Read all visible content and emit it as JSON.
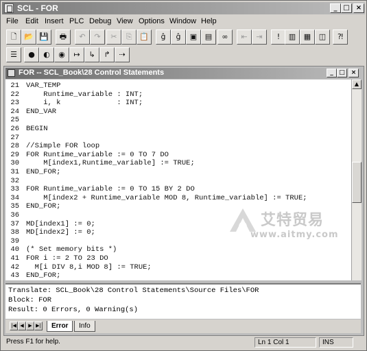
{
  "window": {
    "title": "SCL - FOR",
    "min": "_",
    "max": "□",
    "close": "×"
  },
  "menu": [
    {
      "label": "File"
    },
    {
      "label": "Edit"
    },
    {
      "label": "Insert"
    },
    {
      "label": "PLC"
    },
    {
      "label": "Debug"
    },
    {
      "label": "View"
    },
    {
      "label": "Options"
    },
    {
      "label": "Window"
    },
    {
      "label": "Help"
    }
  ],
  "toolbar1": [
    {
      "icon": "new-file-icon",
      "glyph": "🗋",
      "enabled": true
    },
    {
      "icon": "open-folder-icon",
      "glyph": "📂",
      "enabled": true
    },
    {
      "icon": "save-icon",
      "glyph": "💾",
      "enabled": true
    },
    {
      "icon": "print-icon",
      "glyph": "🖶",
      "enabled": true
    },
    {
      "icon": "undo-icon",
      "glyph": "↶",
      "enabled": false
    },
    {
      "icon": "redo-icon",
      "glyph": "↷",
      "enabled": false
    },
    {
      "icon": "cut-icon",
      "glyph": "✂",
      "enabled": false
    },
    {
      "icon": "copy-icon",
      "glyph": "⎘",
      "enabled": false
    },
    {
      "icon": "paste-icon",
      "glyph": "📋",
      "enabled": false
    },
    {
      "icon": "find-icon",
      "glyph": "ĝ",
      "enabled": true
    },
    {
      "icon": "replace-icon",
      "glyph": "ĝ",
      "enabled": true
    },
    {
      "icon": "compile-icon",
      "glyph": "▣",
      "enabled": true
    },
    {
      "icon": "download-icon",
      "glyph": "▤",
      "enabled": true
    },
    {
      "icon": "monitor-glasses-icon",
      "glyph": "∞",
      "enabled": true
    },
    {
      "icon": "go-to-start-icon",
      "glyph": "⇤",
      "enabled": false
    },
    {
      "icon": "go-to-end-icon",
      "glyph": "⇥",
      "enabled": false
    },
    {
      "icon": "important-icon",
      "glyph": "!",
      "enabled": true
    },
    {
      "icon": "window-cascade-icon",
      "glyph": "▥",
      "enabled": true
    },
    {
      "icon": "window-tile-icon",
      "glyph": "▦",
      "enabled": true
    },
    {
      "icon": "window-split-icon",
      "glyph": "◫",
      "enabled": true
    },
    {
      "icon": "help-what-is-icon",
      "glyph": "⁈",
      "enabled": true
    }
  ],
  "toolbar2": [
    {
      "icon": "list-icon",
      "glyph": "☰",
      "enabled": true
    },
    {
      "icon": "breakpoint-icon",
      "glyph": "●",
      "enabled": true
    },
    {
      "icon": "breakpoint-toggle-icon",
      "glyph": "◐",
      "enabled": true
    },
    {
      "icon": "watch-icon",
      "glyph": "◉",
      "enabled": true
    },
    {
      "icon": "step-icon",
      "glyph": "↦",
      "enabled": true
    },
    {
      "icon": "step-into-icon",
      "glyph": "↳",
      "enabled": true
    },
    {
      "icon": "step-out-icon",
      "glyph": "↱",
      "enabled": true
    },
    {
      "icon": "run-to-cursor-icon",
      "glyph": "⇢",
      "enabled": true
    }
  ],
  "child": {
    "title": "FOR -- SCL_Book\\28 Control Statements",
    "min": "_",
    "max": "□",
    "close": "×"
  },
  "code": [
    {
      "n": "21",
      "t": "VAR_TEMP"
    },
    {
      "n": "22",
      "t": "    Runtime_variable : INT;"
    },
    {
      "n": "23",
      "t": "    i, k             : INT;"
    },
    {
      "n": "24",
      "t": "END_VAR"
    },
    {
      "n": "25",
      "t": ""
    },
    {
      "n": "26",
      "t": "BEGIN"
    },
    {
      "n": "27",
      "t": ""
    },
    {
      "n": "28",
      "t": "//Simple FOR loop"
    },
    {
      "n": "29",
      "t": "FOR Runtime_variable := 0 TO 7 DO"
    },
    {
      "n": "30",
      "t": "    M[index1,Runtime_variable] := TRUE;"
    },
    {
      "n": "31",
      "t": "END_FOR;"
    },
    {
      "n": "32",
      "t": ""
    },
    {
      "n": "33",
      "t": "FOR Runtime_variable := 0 TO 15 BY 2 DO"
    },
    {
      "n": "34",
      "t": "    M[index2 + Runtime_variable MOD 8, Runtime_variable] := TRUE;"
    },
    {
      "n": "35",
      "t": "END_FOR;"
    },
    {
      "n": "36",
      "t": ""
    },
    {
      "n": "37",
      "t": "MD[index1] := 0;"
    },
    {
      "n": "38",
      "t": "MD[index2] := 0;"
    },
    {
      "n": "39",
      "t": ""
    },
    {
      "n": "40",
      "t": "(* Set memory bits *)"
    },
    {
      "n": "41",
      "t": "FOR i := 2 TO 23 DO"
    },
    {
      "n": "42",
      "t": "  M[i DIV 8,i MOD 8] := TRUE;"
    },
    {
      "n": "43",
      "t": "END_FOR;"
    }
  ],
  "output": [
    "Translate: SCL_Book\\28 Control Statements\\Source Files\\FOR",
    "Block: FOR",
    "Result: 0 Errors, 0 Warning(s)"
  ],
  "tabs": [
    {
      "label": "Error"
    },
    {
      "label": "Info"
    }
  ],
  "status": {
    "help": "Press F1 for help.",
    "position": "Ln 1 Col 1",
    "mode": "INS"
  },
  "watermark": {
    "logo_text": "艾特贸易",
    "url": "www.aitmy.com"
  }
}
